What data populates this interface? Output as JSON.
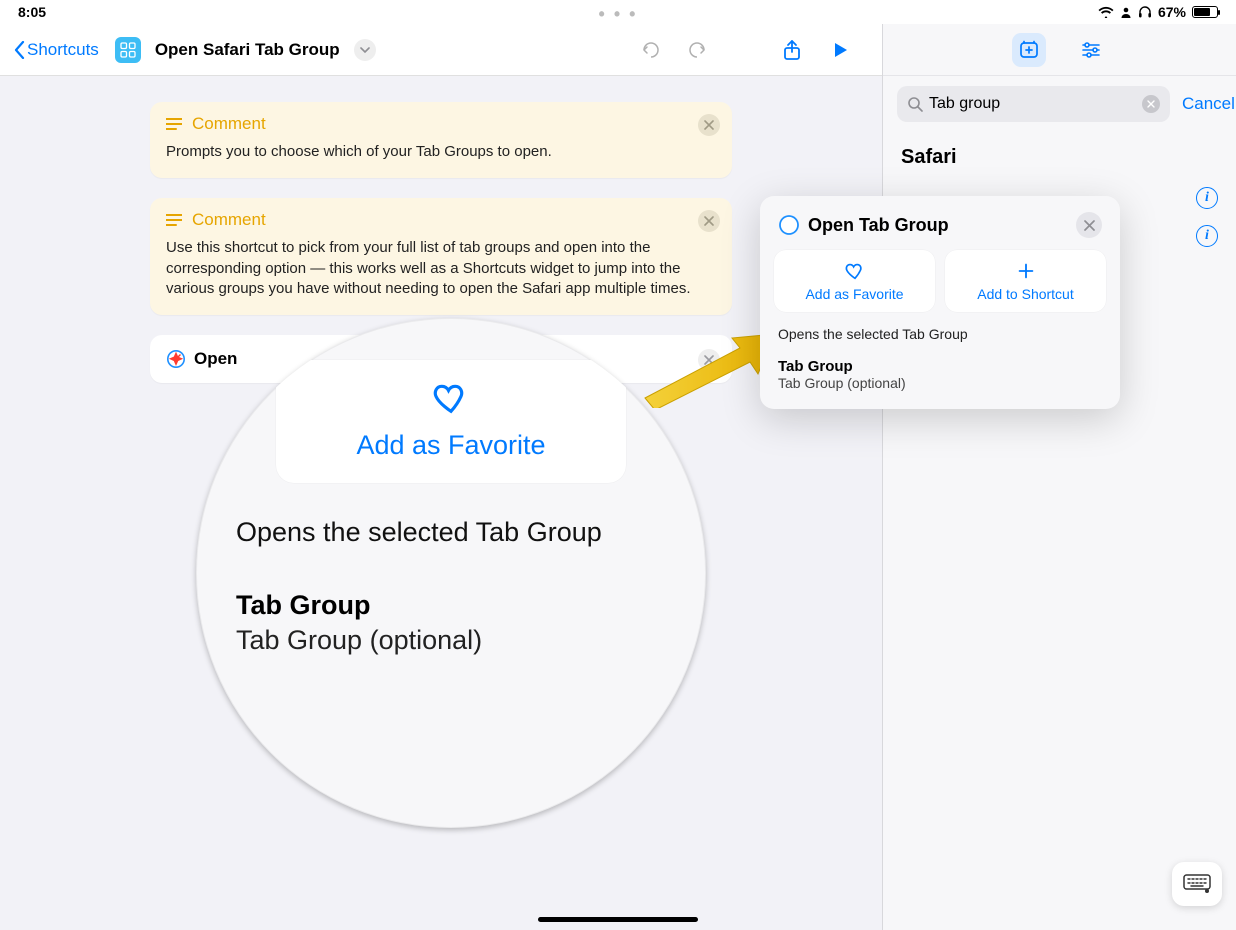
{
  "status": {
    "time": "8:05",
    "battery_pct": "67%"
  },
  "nav": {
    "back_label": "Shortcuts",
    "shortcut_title": "Open Safari Tab Group"
  },
  "comments": [
    {
      "title": "Comment",
      "body": "Prompts you to choose which of your Tab Groups to open."
    },
    {
      "title": "Comment",
      "body": "Use this shortcut to pick from your full list of tab groups and open into the corresponding option — this works well as a Shortcuts widget to jump into the various groups you have without needing to open the Safari app multiple times."
    }
  ],
  "action_row": {
    "verb": "Open"
  },
  "side": {
    "search_value": "Tab group",
    "cancel": "Cancel",
    "section": "Safari"
  },
  "popover": {
    "title": "Open Tab Group",
    "fav_label": "Add as Favorite",
    "add_label": "Add to Shortcut",
    "description": "Opens the selected Tab Group",
    "param_title": "Tab Group",
    "param_sub": "Tab Group (optional)"
  },
  "magnifier": {
    "fav_label": "Add as Favorite",
    "description": "Opens the selected Tab Group",
    "param_title": "Tab Group",
    "param_sub": "Tab Group (optional)"
  }
}
